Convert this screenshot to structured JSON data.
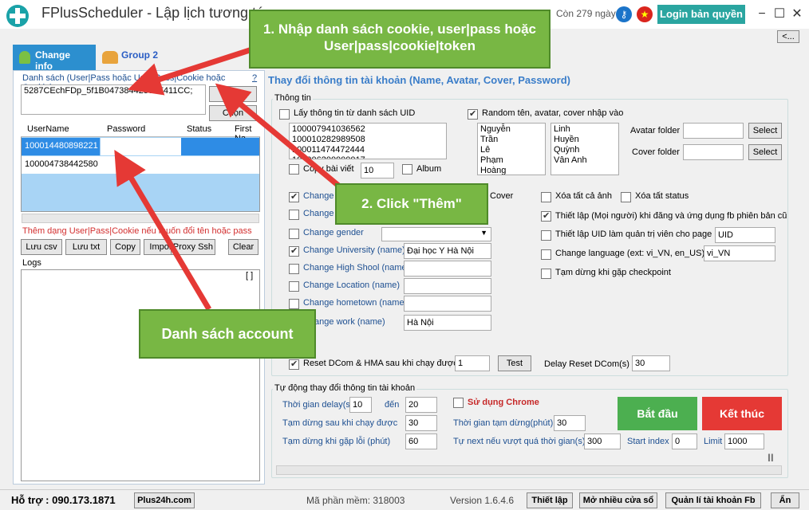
{
  "window": {
    "title": "FPlusScheduler - Lập lịch tương tác",
    "days_left": "Còn 279 ngày",
    "login_button": "Login bản quyền",
    "minimize": "−",
    "maximize": "☐",
    "close": "✕",
    "collapse_button": "<..."
  },
  "tabs": [
    {
      "label": "Change info"
    },
    {
      "label": "Group 2"
    }
  ],
  "left": {
    "list_label": "Danh sách (User|Pass hoặc User|Pass|Cookie hoặc Cookie)",
    "help": "?",
    "input_value": "5287CEchFDp_5f1B04738442580F411CC;",
    "add_button": "Thêm",
    "choose_button": "Chọn",
    "table_headers": [
      "UserName",
      "Password",
      "Status",
      "First Na"
    ],
    "rows": [
      {
        "user": "100014480898221",
        "pass": "",
        "status": ""
      },
      {
        "user": "100004738442580",
        "pass": "",
        "status": ""
      }
    ],
    "note": "Thêm dạng User|Pass|Cookie nếu muốn đổi tên hoặc pass",
    "buttons": [
      "Lưu csv",
      "Lưu txt",
      "Copy",
      "Import",
      "Proxy Ssh",
      "Clear"
    ],
    "logs_label": "Logs",
    "logs_btn": "[ ]"
  },
  "main": {
    "title": "Thay đổi thông tin tài khoản (Name, Avatar, Cover, Password)",
    "group_title": "Thông tin",
    "uid_check": "Lấy thông tin từ danh sách UID",
    "uid_list": [
      "100007941036562",
      "100010282989508",
      "100011474472444",
      "100006200000017"
    ],
    "copy_label": "Copy bài viết",
    "copy_count": "10",
    "album": "Album",
    "random_label": "Random tên, avatar, cover nhập vào",
    "lastnames": [
      "Nguyễn",
      "Trần",
      "Lê",
      "Phạm",
      "Hoàng"
    ],
    "firstnames": [
      "Linh",
      "Huyền",
      "Quỳnh",
      "Vân Anh"
    ],
    "avatar_folder": "Avatar folder",
    "cover_folder": "Cover folder",
    "select": "Select",
    "cover_label": "Cover",
    "change_rows": [
      {
        "label": "Change avatar",
        "checked": true,
        "value": ""
      },
      {
        "label": "Change name",
        "checked": false,
        "value": ""
      },
      {
        "label": "Change gender",
        "checked": false,
        "value": ""
      },
      {
        "label": "Change University (name)",
        "checked": true,
        "value": "Đại học Y Hà Nội"
      },
      {
        "label": "Change High Shool (name)",
        "checked": false,
        "value": ""
      },
      {
        "label": "Change Location (name)",
        "checked": false,
        "value": ""
      },
      {
        "label": "Change hometown (name)",
        "checked": false,
        "value": ""
      },
      {
        "label": "Change work (name)",
        "checked": false,
        "value": "Hà Nội"
      }
    ],
    "xoa_anh": "Xóa tất cả ảnh",
    "xoa_status": "Xóa tất status",
    "thiet_lap_ver": "Thiết lập (Mọi người) khi đăng và ứng dụng fb phiên bản cũ",
    "thiet_lap_uid": "Thiết lập UID làm quản trị viên cho page",
    "uid_value": "UID",
    "change_lang": "Change language (ext: vi_VN, en_US)",
    "lang_value": "vi_VN",
    "tam_dung": "Tạm dừng khi gặp checkpoint",
    "reset_label": "Reset DCom & HMA sau khi chạy được",
    "reset_value": "1",
    "test": "Test",
    "delay_reset": "Delay Reset DCom(s)",
    "delay_reset_value": "30"
  },
  "auto": {
    "group_title": "Tự động thay đổi thông tin tài khoản",
    "delay_label": "Thời gian delay(s)",
    "delay_from": "10",
    "den": "đến",
    "delay_to": "20",
    "chrome": "Sử dụng Chrome",
    "pause_after": "Tạm dừng sau khi chạy được",
    "pause_after_v": "30",
    "pause_time": "Thời gian tạm dừng(phút)",
    "pause_time_v": "30",
    "pause_err": "Tạm dừng khi gặp lỗi (phút)",
    "pause_err_v": "60",
    "next_timeout": "Tự next nếu vượt quá thời gian(s)",
    "next_timeout_v": "300",
    "start_index": "Start index",
    "start_index_v": "0",
    "limit": "Limit",
    "limit_v": "1000",
    "start": "Bắt đầu",
    "stop": "Kết thúc",
    "pause": "II"
  },
  "status": {
    "support": "Hỗ trợ : 090.173.1871",
    "site": "Plus24h.com",
    "code": "Mã phần mềm: 318003",
    "version": "Version 1.6.4.6",
    "settings": "Thiết lập",
    "multi": "Mở nhiều cửa sổ",
    "manage": "Quản lí tài khoản Fb",
    "hide": "Ẩn"
  },
  "callouts": {
    "c1": "1. Nhập danh sách cookie, user|pass hoặc User|pass|cookie|token",
    "c2": "2. Click \"Thêm\"",
    "c3": "Danh sách account"
  },
  "colors": {
    "accent": "#2c8fcf",
    "start": "#4caf50",
    "stop": "#e53935",
    "callout": "#78b744",
    "arrow": "#e53935"
  }
}
